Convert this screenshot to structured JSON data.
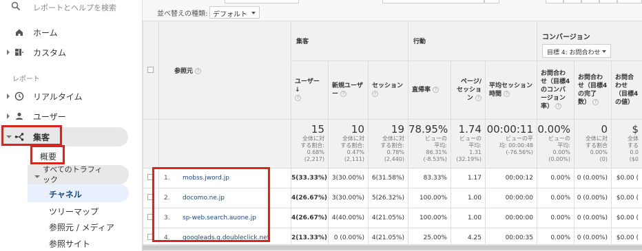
{
  "sidebar": {
    "search_placeholder": "レポートとヘルプを検索",
    "home": "ホーム",
    "custom": "カスタム",
    "reports_section": "レポート",
    "realtime": "リアルタイム",
    "users": "ユーザー",
    "acquisition": "集客",
    "overview": "概要",
    "all_traffic_line1": "すべてのトラフィ",
    "all_traffic_line2": "ック",
    "channels": "チャネル",
    "treemap": "ツリーマップ",
    "source_medium": "参照元 / メディア",
    "referrals": "参照サイト"
  },
  "toolbar": {
    "sort_label": "並べ替えの種類:",
    "sort_value": "デフォルト"
  },
  "table": {
    "ref_header": "参照元",
    "group_acquisition": "集客",
    "group_behavior": "行動",
    "group_conversion": "コンバージョン",
    "goal_select": "目標 4: お問合わせ",
    "headers": {
      "users": "ユーザー",
      "new_users": "新規ユーザー",
      "sessions": "セッション",
      "bounce_rate": "直帰率",
      "pages_per_session": "ページ/セッション",
      "avg_session_duration": "平均セッション時間",
      "goal_cvr": "お問合わせ（目標4のコンバージョン率）",
      "goal_completions": "お問合わせ（目標4の完了数）",
      "goal_value": "お問合わせ（目標4の値）"
    },
    "totals": {
      "users": {
        "value": "15",
        "sub1": "全体に対",
        "sub2": "する割合:",
        "sub3": "0.68%",
        "sub4": "(2,217)"
      },
      "new_users": {
        "value": "10",
        "sub1": "全体に対",
        "sub2": "する割合:",
        "sub3": "0.47%",
        "sub4": "(2,111)"
      },
      "sessions": {
        "value": "19",
        "sub1": "全体に対",
        "sub2": "する割合:",
        "sub3": "0.78%",
        "sub4": "(2,440)"
      },
      "bounce_rate": {
        "value": "78.95%",
        "sub1": "ビューの",
        "sub2": "平均:",
        "sub3": "86.31%",
        "sub4": "(-8.53%)"
      },
      "pages_per_session": {
        "value": "1.74",
        "sub1": "ビューの",
        "sub2": "平均:",
        "sub3": "1.31",
        "sub4": "(32.19%)"
      },
      "avg_session_duration": {
        "value": "00:00:11",
        "sub1": "ビューの平",
        "sub2": "均: 00:00:48",
        "sub3": "(-76.56%)",
        "sub4": ""
      },
      "goal_cvr": {
        "value": "0.00%",
        "sub1": "ビューの",
        "sub2": "平均:",
        "sub3": "0.00%",
        "sub4": "(0.00%)"
      },
      "goal_completions": {
        "value": "0",
        "sub1": "全体に対",
        "sub2": "する割合",
        "sub3": "0.00%",
        "sub4": "(0)"
      },
      "goal_value": {
        "value": "$",
        "sub1": "全体",
        "sub2": "する",
        "sub3": "0.0",
        "sub4": "($0"
      }
    },
    "rows": [
      {
        "num": "1.",
        "source": "mobss.jword.jp",
        "users": "5(33.33%)",
        "new_users": "3(30.00%)",
        "sessions": "6(31.58%)",
        "bounce": "83.33%",
        "pps": "1.17",
        "dur": "00:00:12",
        "cvr": "0.00%",
        "comp": "0 (0.00%)",
        "val": "$0.00 ("
      },
      {
        "num": "2.",
        "source": "docomo.ne.jp",
        "users": "4(26.67%)",
        "new_users": "3(30.00%)",
        "sessions": "5(26.32%)",
        "bounce": "100.00%",
        "pps": "1.00",
        "dur": "00:00:00",
        "cvr": "0.00%",
        "comp": "0 (0.00%)",
        "val": "$0.00 ("
      },
      {
        "num": "3.",
        "source": "sp-web.search.auone.jp",
        "users": "4(26.67%)",
        "new_users": "4(40.00%)",
        "sessions": "4(21.05%)",
        "bounce": "100.00%",
        "pps": "1.00",
        "dur": "00:00:00",
        "cvr": "0.00%",
        "comp": "0 (0.00%)",
        "val": "$0.00 ("
      },
      {
        "num": "4.",
        "source": "googleads.g.doubleclick.net",
        "users": "2(13.33%)",
        "new_users": "0 (0.00%)",
        "sessions": "4(21.05%)",
        "bounce": "25.00%",
        "pps": "4.25",
        "dur": "00:00:35",
        "cvr": "0.00%",
        "comp": "0 (0.00%)",
        "val": "$0.00 ("
      }
    ]
  },
  "colors": {
    "highlight": "#d9261c",
    "link": "#1a4b8c",
    "active_nav": "#e8f0fe"
  },
  "icons": [
    "search-icon",
    "home-icon",
    "dashboard-icon",
    "clock-icon",
    "person-icon",
    "acquisition-icon",
    "help-icon",
    "chevron-down-icon",
    "sort-arrow-icon"
  ]
}
